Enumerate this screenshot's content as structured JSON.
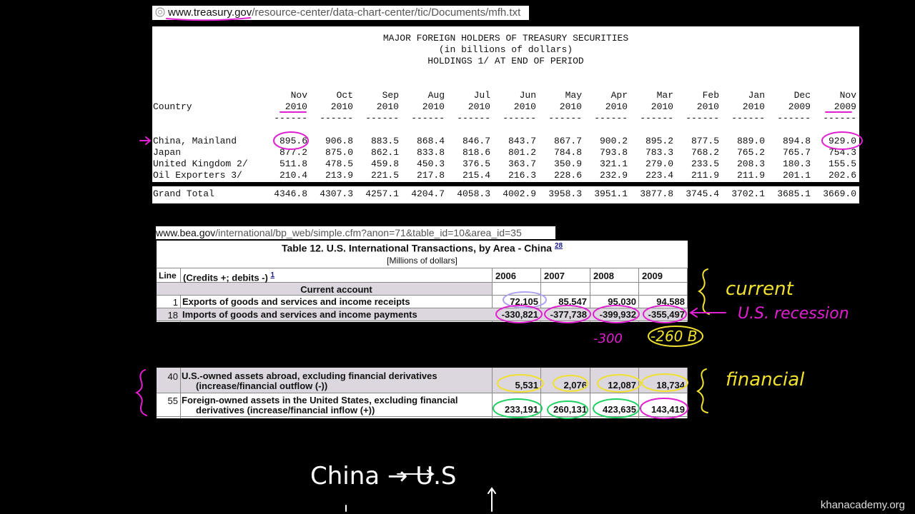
{
  "treasury_url": {
    "domain": "www.treasury.gov",
    "path": "/resource-center/data-chart-center/tic/Documents/mfh.txt"
  },
  "treasury": {
    "title": "MAJOR FOREIGN HOLDERS OF TREASURY SECURITIES",
    "subtitle": "(in billions of dollars)",
    "subtitle2": "HOLDINGS 1/ AT END OF PERIOD",
    "country_header": "Country",
    "months": [
      "Nov",
      "Oct",
      "Sep",
      "Aug",
      "Jul",
      "Jun",
      "May",
      "Apr",
      "Mar",
      "Feb",
      "Jan",
      "Dec",
      "Nov"
    ],
    "years": [
      "2010",
      "2010",
      "2010",
      "2010",
      "2010",
      "2010",
      "2010",
      "2010",
      "2010",
      "2010",
      "2010",
      "2009",
      "2009"
    ],
    "dash": "------",
    "rows": [
      {
        "country": "China, Mainland",
        "values": [
          "895.6",
          "906.8",
          "883.5",
          "868.4",
          "846.7",
          "843.7",
          "867.7",
          "900.2",
          "895.2",
          "877.5",
          "889.0",
          "894.8",
          "929.0"
        ]
      },
      {
        "country": "Japan",
        "values": [
          "877.2",
          "875.0",
          "862.1",
          "833.8",
          "818.6",
          "801.2",
          "784.8",
          "793.8",
          "783.3",
          "768.2",
          "765.2",
          "765.7",
          "754.3"
        ]
      },
      {
        "country": "United Kingdom 2/",
        "values": [
          "511.8",
          "478.5",
          "459.8",
          "450.3",
          "376.5",
          "363.7",
          "350.9",
          "321.1",
          "279.0",
          "233.5",
          "208.3",
          "180.3",
          "155.5"
        ]
      },
      {
        "country": "Oil Exporters 3/",
        "values": [
          "210.4",
          "213.9",
          "221.5",
          "217.8",
          "215.4",
          "216.3",
          "228.6",
          "232.9",
          "223.4",
          "211.9",
          "211.9",
          "201.1",
          "202.6"
        ]
      }
    ],
    "grand_total": {
      "label": "Grand Total",
      "values": [
        "4346.8",
        "4307.3",
        "4257.1",
        "4204.7",
        "4058.3",
        "4002.9",
        "3958.3",
        "3951.1",
        "3877.8",
        "3745.4",
        "3702.1",
        "3685.1",
        "3669.0"
      ]
    }
  },
  "bea_url": {
    "domain": "www.bea.gov",
    "path": "/international/bp_web/simple.cfm?anon=71&table_id=10&area_id=35"
  },
  "bea": {
    "title": "Table 12. U.S. International Transactions, by Area - China",
    "title_footnote": "28",
    "subtitle": "[Millions of dollars]",
    "line_header": "Line",
    "desc_header": "(Credits +; debits -)",
    "desc_footnote": "1",
    "years": [
      "2006",
      "2007",
      "2008",
      "2009"
    ],
    "section": "Current account",
    "rows": [
      {
        "line": "1",
        "desc": "Exports of goods and services and income receipts",
        "values": [
          "72,105",
          "85,547",
          "95,030",
          "94,588"
        ]
      },
      {
        "line": "18",
        "desc": "Imports of goods and services and income payments",
        "values": [
          "-330,821",
          "-377,738",
          "-399,932",
          "-355,497"
        ]
      }
    ],
    "rows2": [
      {
        "line": "40",
        "desc1": "U.S.-owned assets abroad, excluding financial derivatives",
        "desc2": "(increase/financial outflow (-))",
        "values": [
          "5,531",
          "2,076",
          "12,087",
          "18,734"
        ]
      },
      {
        "line": "55",
        "desc1": "Foreign-owned assets in the United States, excluding financial",
        "desc2": "derivatives (increase/financial inflow (+))",
        "values": [
          "233,191",
          "260,131",
          "423,635",
          "143,419"
        ]
      }
    ]
  },
  "annotations": {
    "current": "current",
    "recession": "U.S. recession",
    "minus300": "-300",
    "minus260": "-260 B",
    "financial": "financial",
    "china_us": "China → U.S"
  },
  "watermark": "khanacademy.org",
  "colors": {
    "magenta": "#e020d0",
    "yellow": "#f0e030",
    "green": "#20d060",
    "lavender": "#b0a0f0"
  }
}
